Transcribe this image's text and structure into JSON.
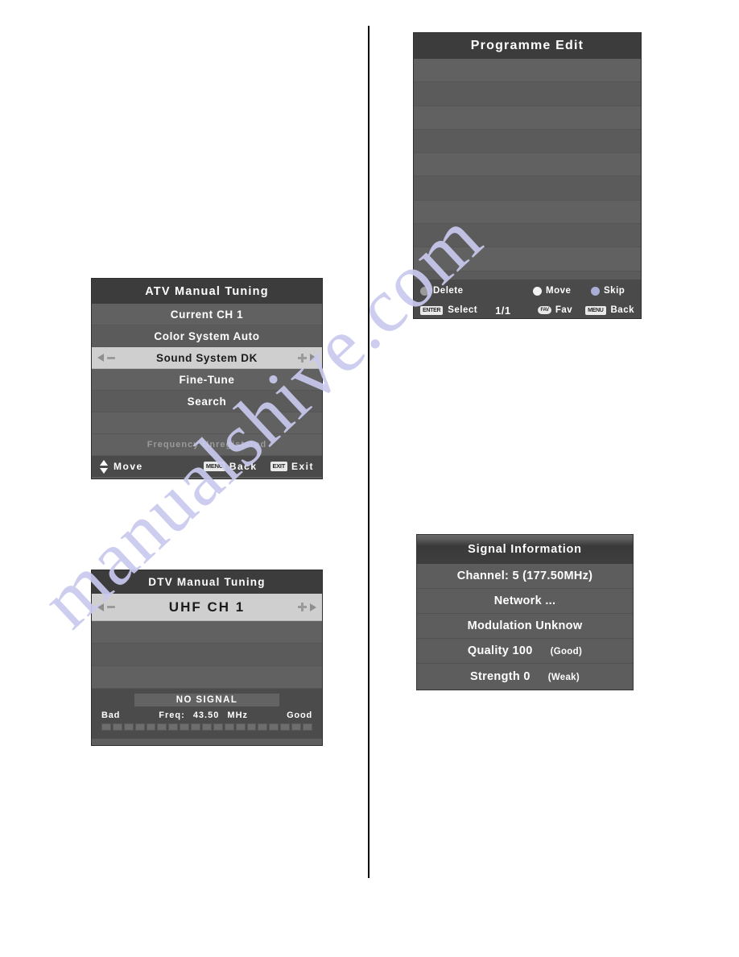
{
  "page": {
    "watermark": "manualshive.com",
    "background_color": "#ffffff",
    "divider_color": "#000000"
  },
  "atv_menu": {
    "title": "ATV Manual Tuning",
    "rows": [
      {
        "label": "Current CH 1",
        "selected": false
      },
      {
        "label": "Color System Auto",
        "selected": false
      },
      {
        "label": "Sound System DK",
        "selected": true
      },
      {
        "label": "Fine-Tune",
        "selected": false
      },
      {
        "label": "Search",
        "selected": false
      },
      {
        "label": "",
        "selected": false
      }
    ],
    "note": "Frequency Unregistered",
    "footer": {
      "move_label": "Move",
      "menu_key": "MENU",
      "back_label": "Back",
      "exit_key": "EXIT",
      "exit_label": "Exit"
    }
  },
  "dtv_menu": {
    "title": "DTV Manual Tuning",
    "selected_row": "UHF  CH  1",
    "blank_rows": 3,
    "status": "NO SIGNAL",
    "meter": {
      "bad_label": "Bad",
      "good_label": "Good",
      "freq_label": "Freq:",
      "freq_value": "43.50",
      "freq_unit": "MHz",
      "segments": 19,
      "filled": 0
    }
  },
  "programme_edit": {
    "title": "Programme Edit",
    "rows": [
      "",
      "",
      "",
      "",
      "",
      "",
      "",
      "",
      "",
      ""
    ],
    "footer": {
      "delete_label": "Delete",
      "delete_color": "#9a9a9a",
      "move_label": "Move",
      "move_color": "#f2f2f2",
      "skip_label": "Skip",
      "skip_color": "#a9aed6",
      "enter_key": "ENTER",
      "select_label": "Select",
      "page_indicator": "1/1",
      "fav_key": "FAV",
      "fav_label": "Fav",
      "menu_key": "MENU",
      "back_label": "Back"
    }
  },
  "signal_information": {
    "title": "Signal Information",
    "rows": [
      {
        "label": "Channel: 5 (177.50MHz)",
        "value": ""
      },
      {
        "label": "Network ...",
        "value": ""
      },
      {
        "label": "Modulation Unknow",
        "value": ""
      },
      {
        "label": "Quality 100",
        "value": "(Good)"
      },
      {
        "label": "Strength 0",
        "value": "(Weak)"
      }
    ]
  }
}
